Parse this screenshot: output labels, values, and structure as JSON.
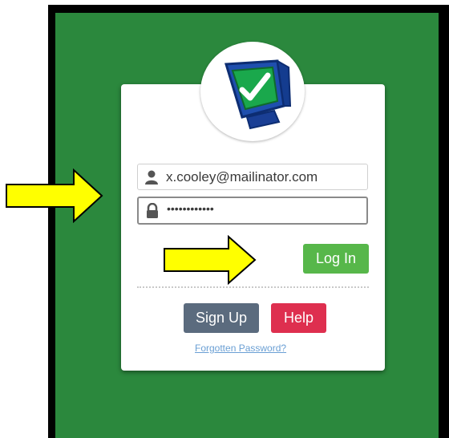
{
  "login_form": {
    "email_value": "x.cooley@mailinator.com",
    "password_masked": "••••••••••••",
    "login_label": "Log In",
    "signup_label": "Sign Up",
    "help_label": "Help",
    "forgot_label": "Forgotten Password?"
  },
  "icons": {
    "logo": "monitor-checkmark-logo-icon",
    "email": "user-icon",
    "password": "lock-icon",
    "annotation": "yellow-arrow-icon"
  },
  "colors": {
    "background_green": "#2b883d",
    "login_button": "#57b74a",
    "signup_button": "#5b6b7e",
    "help_button": "#de2f4f",
    "link": "#6a9fd4",
    "arrow_fill": "#ffff00"
  }
}
